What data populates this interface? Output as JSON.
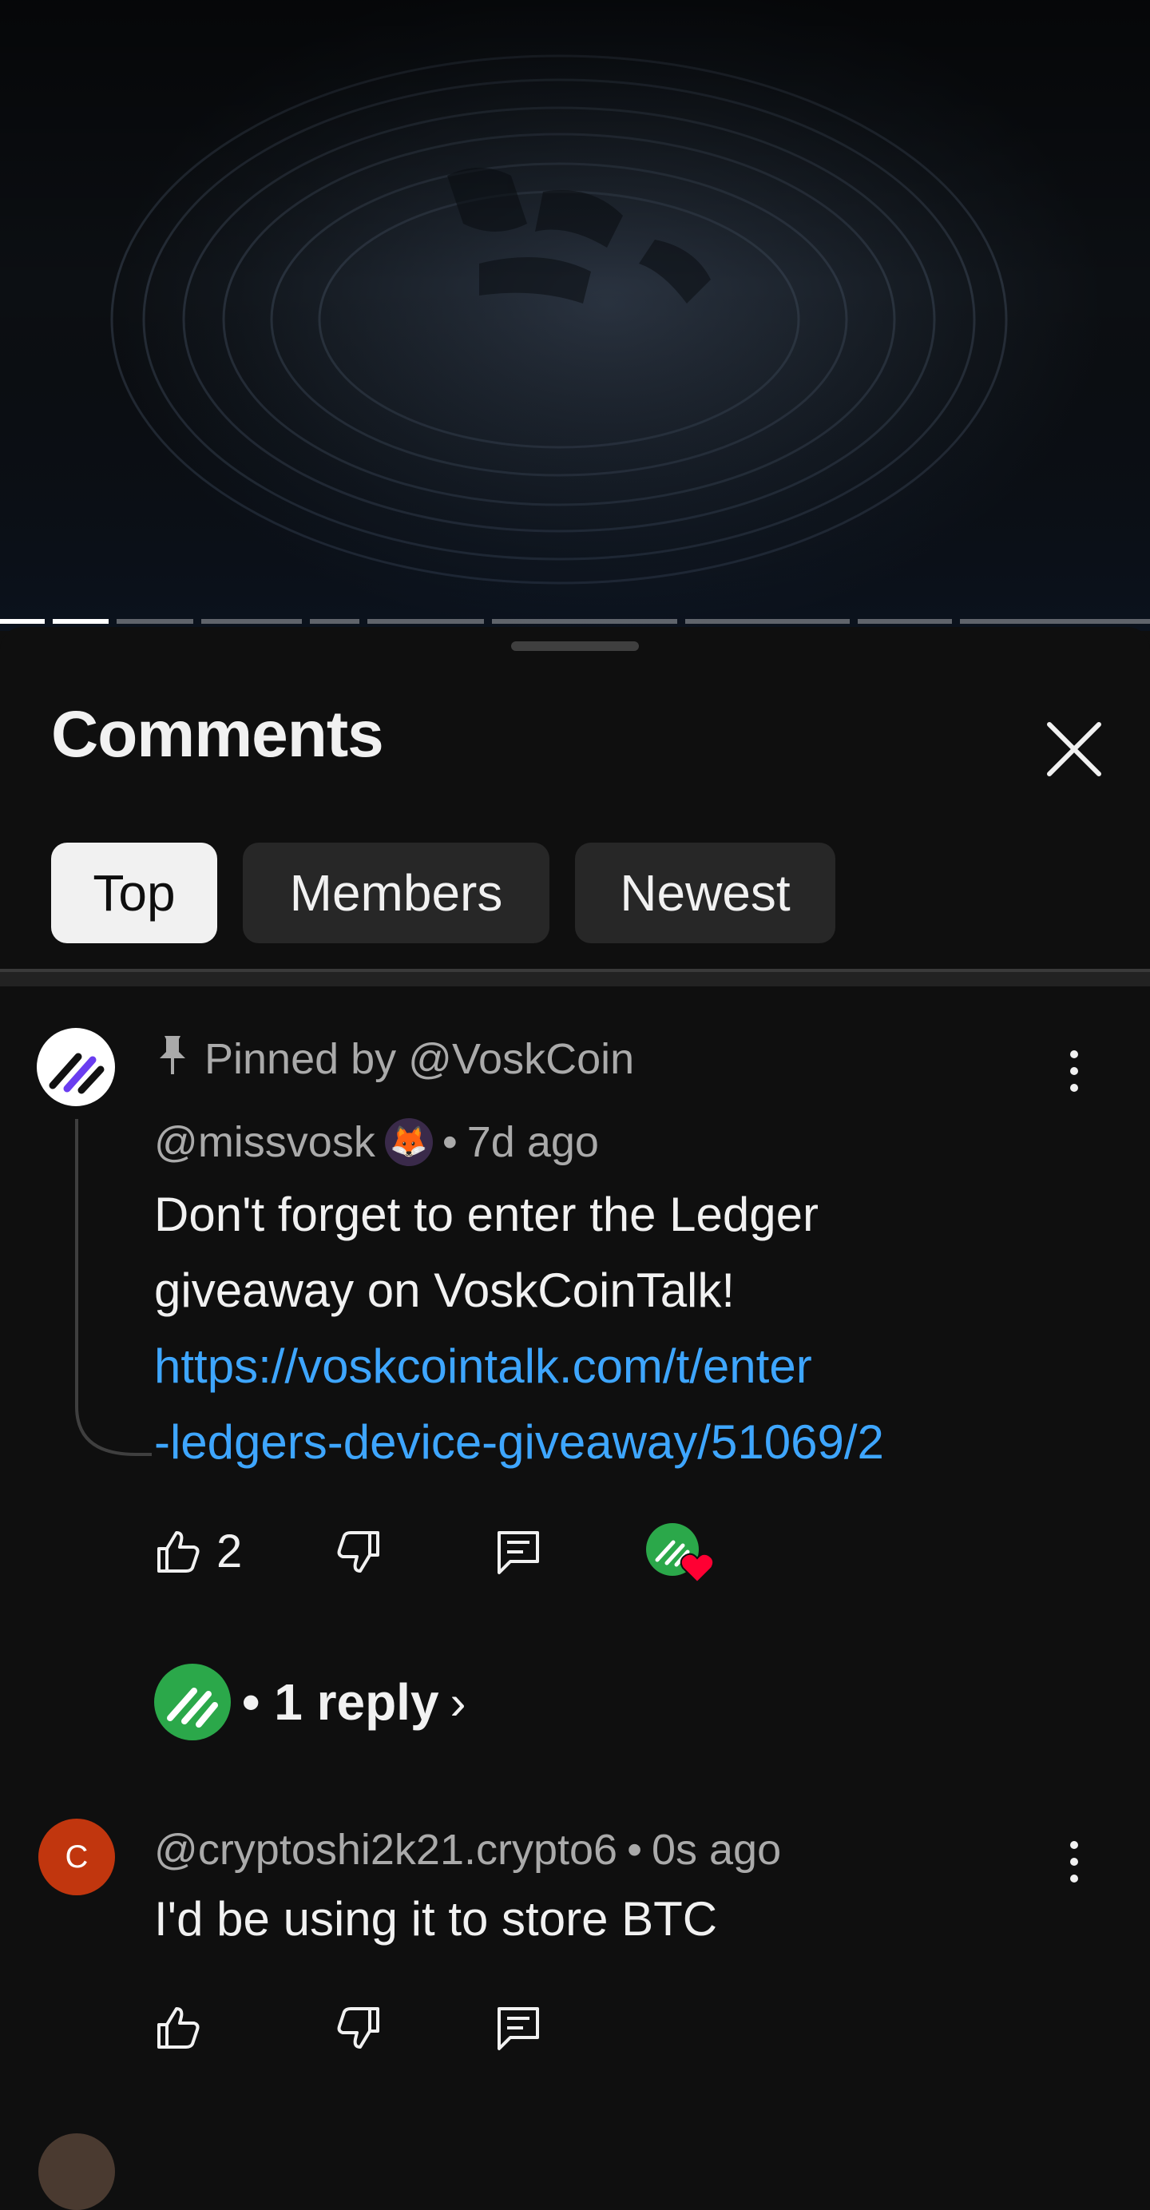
{
  "video": {
    "progress_segments": 11,
    "active_segment": 2
  },
  "comments_panel": {
    "title": "Comments",
    "filters": [
      "Top",
      "Members",
      "Newest"
    ],
    "selected_filter": "Top"
  },
  "comments": [
    {
      "pinned_label": "Pinned by @VoskCoin",
      "author": "@missvosk",
      "author_badge": "🦊",
      "separator": "•",
      "time": "7d ago",
      "text_lines": [
        "Don't forget to enter the Ledger",
        "giveaway on VoskCoinTalk!"
      ],
      "link_lines": [
        "https://voskcointalk.com/t/enter",
        "-ledgers-device-giveaway/51069/2"
      ],
      "like_count": "2",
      "creator_heart": true,
      "replies_label": "• 1 reply",
      "replies_chevron": "›"
    },
    {
      "avatar_letter": "C",
      "author": "@cryptoshi2k21.crypto6",
      "separator": "•",
      "time": "0s ago",
      "text": "I'd be using it to store BTC"
    }
  ],
  "colors": {
    "background": "#0f0f0f",
    "link": "#3ea6ff",
    "chip": "#272727",
    "chip_selected": "#f1f1f1",
    "heart": "#ff0033",
    "avatar_c": "#c1360e",
    "channel_green": "#2ba84a"
  },
  "icons": [
    "close-icon",
    "pin-icon",
    "like-icon",
    "dislike-icon",
    "reply-icon",
    "more-vert-icon",
    "chevron-right-icon"
  ]
}
